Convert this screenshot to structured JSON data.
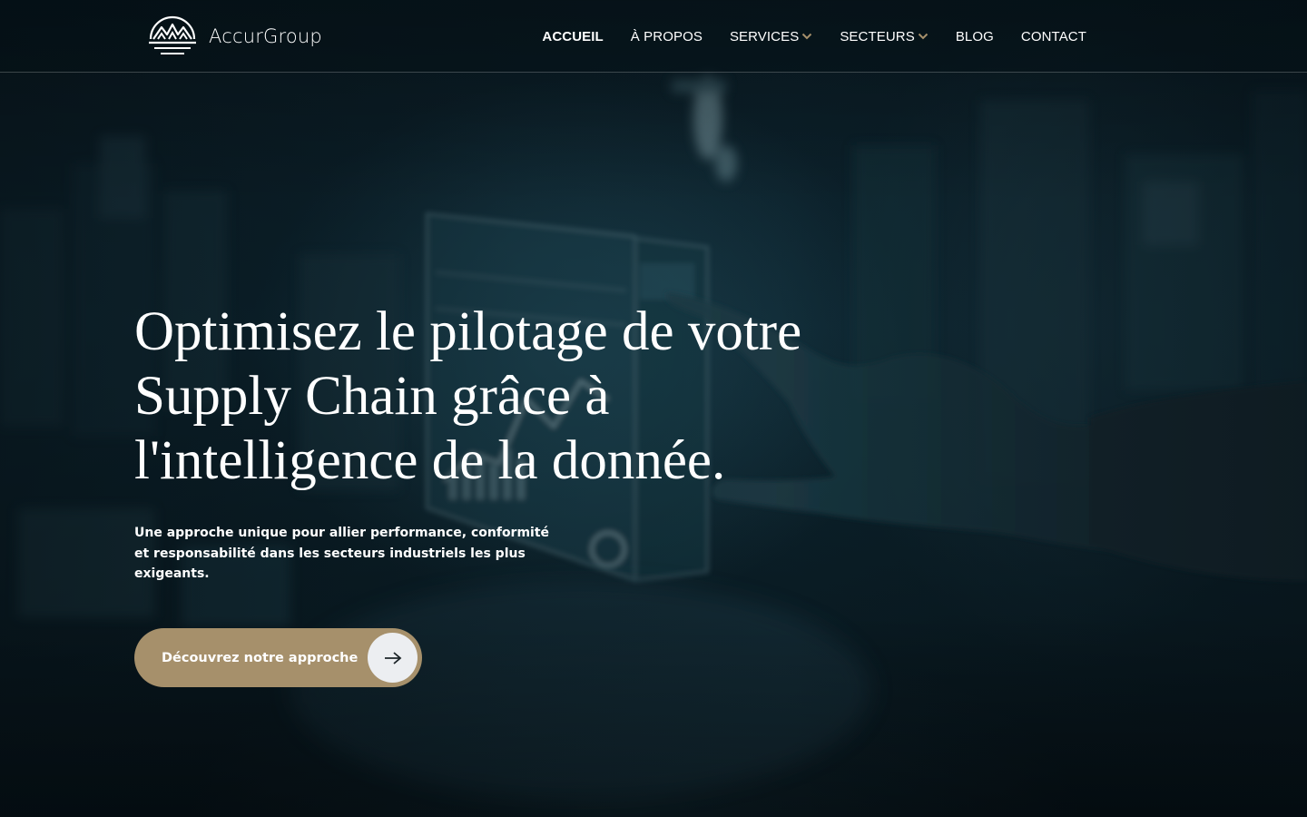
{
  "brand": {
    "name": "AccurGroup"
  },
  "nav": {
    "items": [
      {
        "label": "ACCUEIL",
        "active": true,
        "has_dropdown": false
      },
      {
        "label": "À PROPOS",
        "active": false,
        "has_dropdown": false
      },
      {
        "label": "SERVICES",
        "active": false,
        "has_dropdown": true
      },
      {
        "label": "SECTEURS",
        "active": false,
        "has_dropdown": true
      },
      {
        "label": "BLOG",
        "active": false,
        "has_dropdown": false
      },
      {
        "label": "CONTACT",
        "active": false,
        "has_dropdown": false
      }
    ]
  },
  "hero": {
    "headline": "Optimisez le pilotage de votre Supply Chain grâce à l'intelligence de la donnée.",
    "subtext": "Une approche unique pour allier performance, conformité et responsabilité dans les secteurs industriels les plus exigeants.",
    "cta_label": "Découvrez notre approche",
    "cta_icon": "arrow-right-icon"
  },
  "colors": {
    "accent_gold": "#a6906b",
    "background_dark": "#0b1d26",
    "text": "#ffffff"
  }
}
